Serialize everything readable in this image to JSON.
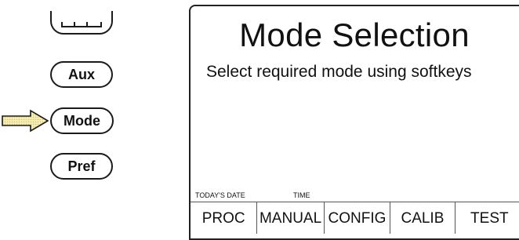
{
  "buttons": {
    "aux_label": "Aux",
    "mode_label": "Mode",
    "pref_label": "Pref"
  },
  "screen": {
    "title": "Mode Selection",
    "subtitle": "Select required mode using softkeys",
    "status": {
      "date_label": "TODAY'S DATE",
      "time_label": "TIME"
    },
    "softkeys": [
      "PROC",
      "MANUAL",
      "CONFIG",
      "CALIB",
      "TEST"
    ]
  },
  "colors": {
    "arrow_fill": "#f3e7a2",
    "outline": "#1a1a1a"
  }
}
